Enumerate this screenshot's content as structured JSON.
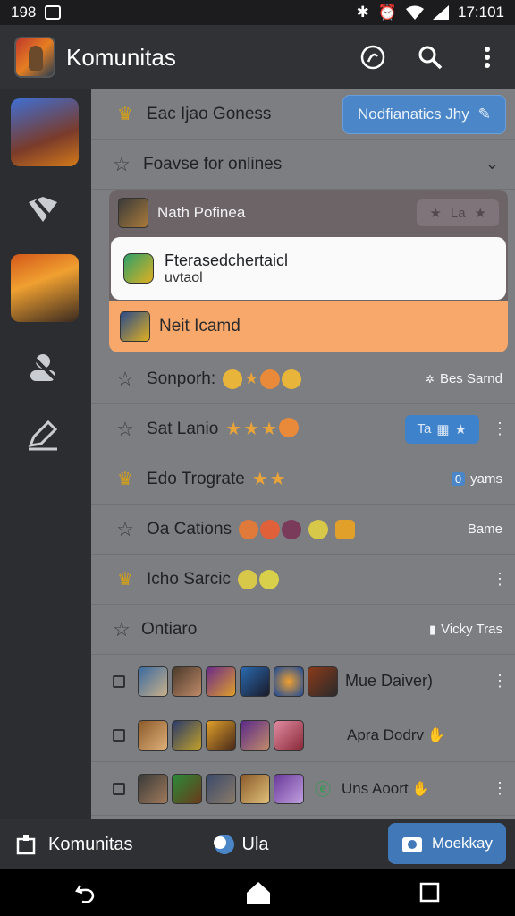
{
  "status_bar": {
    "left_text": "198",
    "time": "17:101"
  },
  "app_bar": {
    "title": "Komunitas"
  },
  "rows": {
    "r1": {
      "title": "Eac Ijao Goness",
      "button": "Nodfianatics Jhy"
    },
    "r2": {
      "title": "Foavse for onlines"
    },
    "group": {
      "header": "Nath Pofinea",
      "chip": "La",
      "white_title": "Fterasedchertaicl",
      "white_sub": "uvtaol",
      "orange_title": "Neit Icamd"
    },
    "r3": {
      "title": "Sonporh:",
      "right": "Bes Sarnd"
    },
    "r4": {
      "title": "Sat Lanio",
      "pill": "Ta"
    },
    "r5": {
      "title": "Edo Trograte",
      "right": "yams",
      "badge": "0"
    },
    "r6": {
      "title": "Oa Cations",
      "right": "Bame"
    },
    "r7": {
      "title": "Icho Sarcic"
    },
    "r8": {
      "title": "Ontiaro",
      "right": "Vicky Tras"
    },
    "c1": {
      "label": "Mue Daiver)"
    },
    "c2": {
      "label": "Apra Dodrv"
    },
    "c3": {
      "label": "Uns Aoort"
    }
  },
  "bottom_nav": {
    "home": "Komunitas",
    "middle": "Ula",
    "active": "Moekkay"
  },
  "colors": {
    "accent": "#4a86c8",
    "orange": "#f9a86b",
    "crown": "#d4a017"
  }
}
